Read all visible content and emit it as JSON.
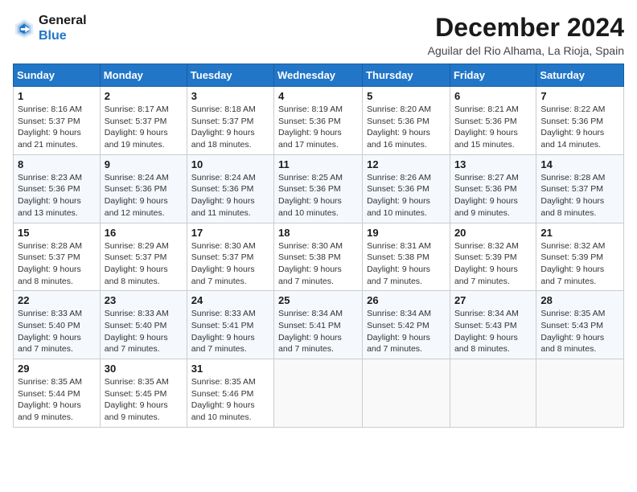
{
  "logo": {
    "line1": "General",
    "line2": "Blue"
  },
  "title": "December 2024",
  "subtitle": "Aguilar del Rio Alhama, La Rioja, Spain",
  "days_header": [
    "Sunday",
    "Monday",
    "Tuesday",
    "Wednesday",
    "Thursday",
    "Friday",
    "Saturday"
  ],
  "weeks": [
    [
      {
        "day": "1",
        "sunrise": "8:16 AM",
        "sunset": "5:37 PM",
        "daylight": "9 hours and 21 minutes."
      },
      {
        "day": "2",
        "sunrise": "8:17 AM",
        "sunset": "5:37 PM",
        "daylight": "9 hours and 19 minutes."
      },
      {
        "day": "3",
        "sunrise": "8:18 AM",
        "sunset": "5:37 PM",
        "daylight": "9 hours and 18 minutes."
      },
      {
        "day": "4",
        "sunrise": "8:19 AM",
        "sunset": "5:36 PM",
        "daylight": "9 hours and 17 minutes."
      },
      {
        "day": "5",
        "sunrise": "8:20 AM",
        "sunset": "5:36 PM",
        "daylight": "9 hours and 16 minutes."
      },
      {
        "day": "6",
        "sunrise": "8:21 AM",
        "sunset": "5:36 PM",
        "daylight": "9 hours and 15 minutes."
      },
      {
        "day": "7",
        "sunrise": "8:22 AM",
        "sunset": "5:36 PM",
        "daylight": "9 hours and 14 minutes."
      }
    ],
    [
      {
        "day": "8",
        "sunrise": "8:23 AM",
        "sunset": "5:36 PM",
        "daylight": "9 hours and 13 minutes."
      },
      {
        "day": "9",
        "sunrise": "8:24 AM",
        "sunset": "5:36 PM",
        "daylight": "9 hours and 12 minutes."
      },
      {
        "day": "10",
        "sunrise": "8:24 AM",
        "sunset": "5:36 PM",
        "daylight": "9 hours and 11 minutes."
      },
      {
        "day": "11",
        "sunrise": "8:25 AM",
        "sunset": "5:36 PM",
        "daylight": "9 hours and 10 minutes."
      },
      {
        "day": "12",
        "sunrise": "8:26 AM",
        "sunset": "5:36 PM",
        "daylight": "9 hours and 10 minutes."
      },
      {
        "day": "13",
        "sunrise": "8:27 AM",
        "sunset": "5:36 PM",
        "daylight": "9 hours and 9 minutes."
      },
      {
        "day": "14",
        "sunrise": "8:28 AM",
        "sunset": "5:37 PM",
        "daylight": "9 hours and 8 minutes."
      }
    ],
    [
      {
        "day": "15",
        "sunrise": "8:28 AM",
        "sunset": "5:37 PM",
        "daylight": "9 hours and 8 minutes."
      },
      {
        "day": "16",
        "sunrise": "8:29 AM",
        "sunset": "5:37 PM",
        "daylight": "9 hours and 8 minutes."
      },
      {
        "day": "17",
        "sunrise": "8:30 AM",
        "sunset": "5:37 PM",
        "daylight": "9 hours and 7 minutes."
      },
      {
        "day": "18",
        "sunrise": "8:30 AM",
        "sunset": "5:38 PM",
        "daylight": "9 hours and 7 minutes."
      },
      {
        "day": "19",
        "sunrise": "8:31 AM",
        "sunset": "5:38 PM",
        "daylight": "9 hours and 7 minutes."
      },
      {
        "day": "20",
        "sunrise": "8:32 AM",
        "sunset": "5:39 PM",
        "daylight": "9 hours and 7 minutes."
      },
      {
        "day": "21",
        "sunrise": "8:32 AM",
        "sunset": "5:39 PM",
        "daylight": "9 hours and 7 minutes."
      }
    ],
    [
      {
        "day": "22",
        "sunrise": "8:33 AM",
        "sunset": "5:40 PM",
        "daylight": "9 hours and 7 minutes."
      },
      {
        "day": "23",
        "sunrise": "8:33 AM",
        "sunset": "5:40 PM",
        "daylight": "9 hours and 7 minutes."
      },
      {
        "day": "24",
        "sunrise": "8:33 AM",
        "sunset": "5:41 PM",
        "daylight": "9 hours and 7 minutes."
      },
      {
        "day": "25",
        "sunrise": "8:34 AM",
        "sunset": "5:41 PM",
        "daylight": "9 hours and 7 minutes."
      },
      {
        "day": "26",
        "sunrise": "8:34 AM",
        "sunset": "5:42 PM",
        "daylight": "9 hours and 7 minutes."
      },
      {
        "day": "27",
        "sunrise": "8:34 AM",
        "sunset": "5:43 PM",
        "daylight": "9 hours and 8 minutes."
      },
      {
        "day": "28",
        "sunrise": "8:35 AM",
        "sunset": "5:43 PM",
        "daylight": "9 hours and 8 minutes."
      }
    ],
    [
      {
        "day": "29",
        "sunrise": "8:35 AM",
        "sunset": "5:44 PM",
        "daylight": "9 hours and 9 minutes."
      },
      {
        "day": "30",
        "sunrise": "8:35 AM",
        "sunset": "5:45 PM",
        "daylight": "9 hours and 9 minutes."
      },
      {
        "day": "31",
        "sunrise": "8:35 AM",
        "sunset": "5:46 PM",
        "daylight": "9 hours and 10 minutes."
      },
      null,
      null,
      null,
      null
    ]
  ]
}
